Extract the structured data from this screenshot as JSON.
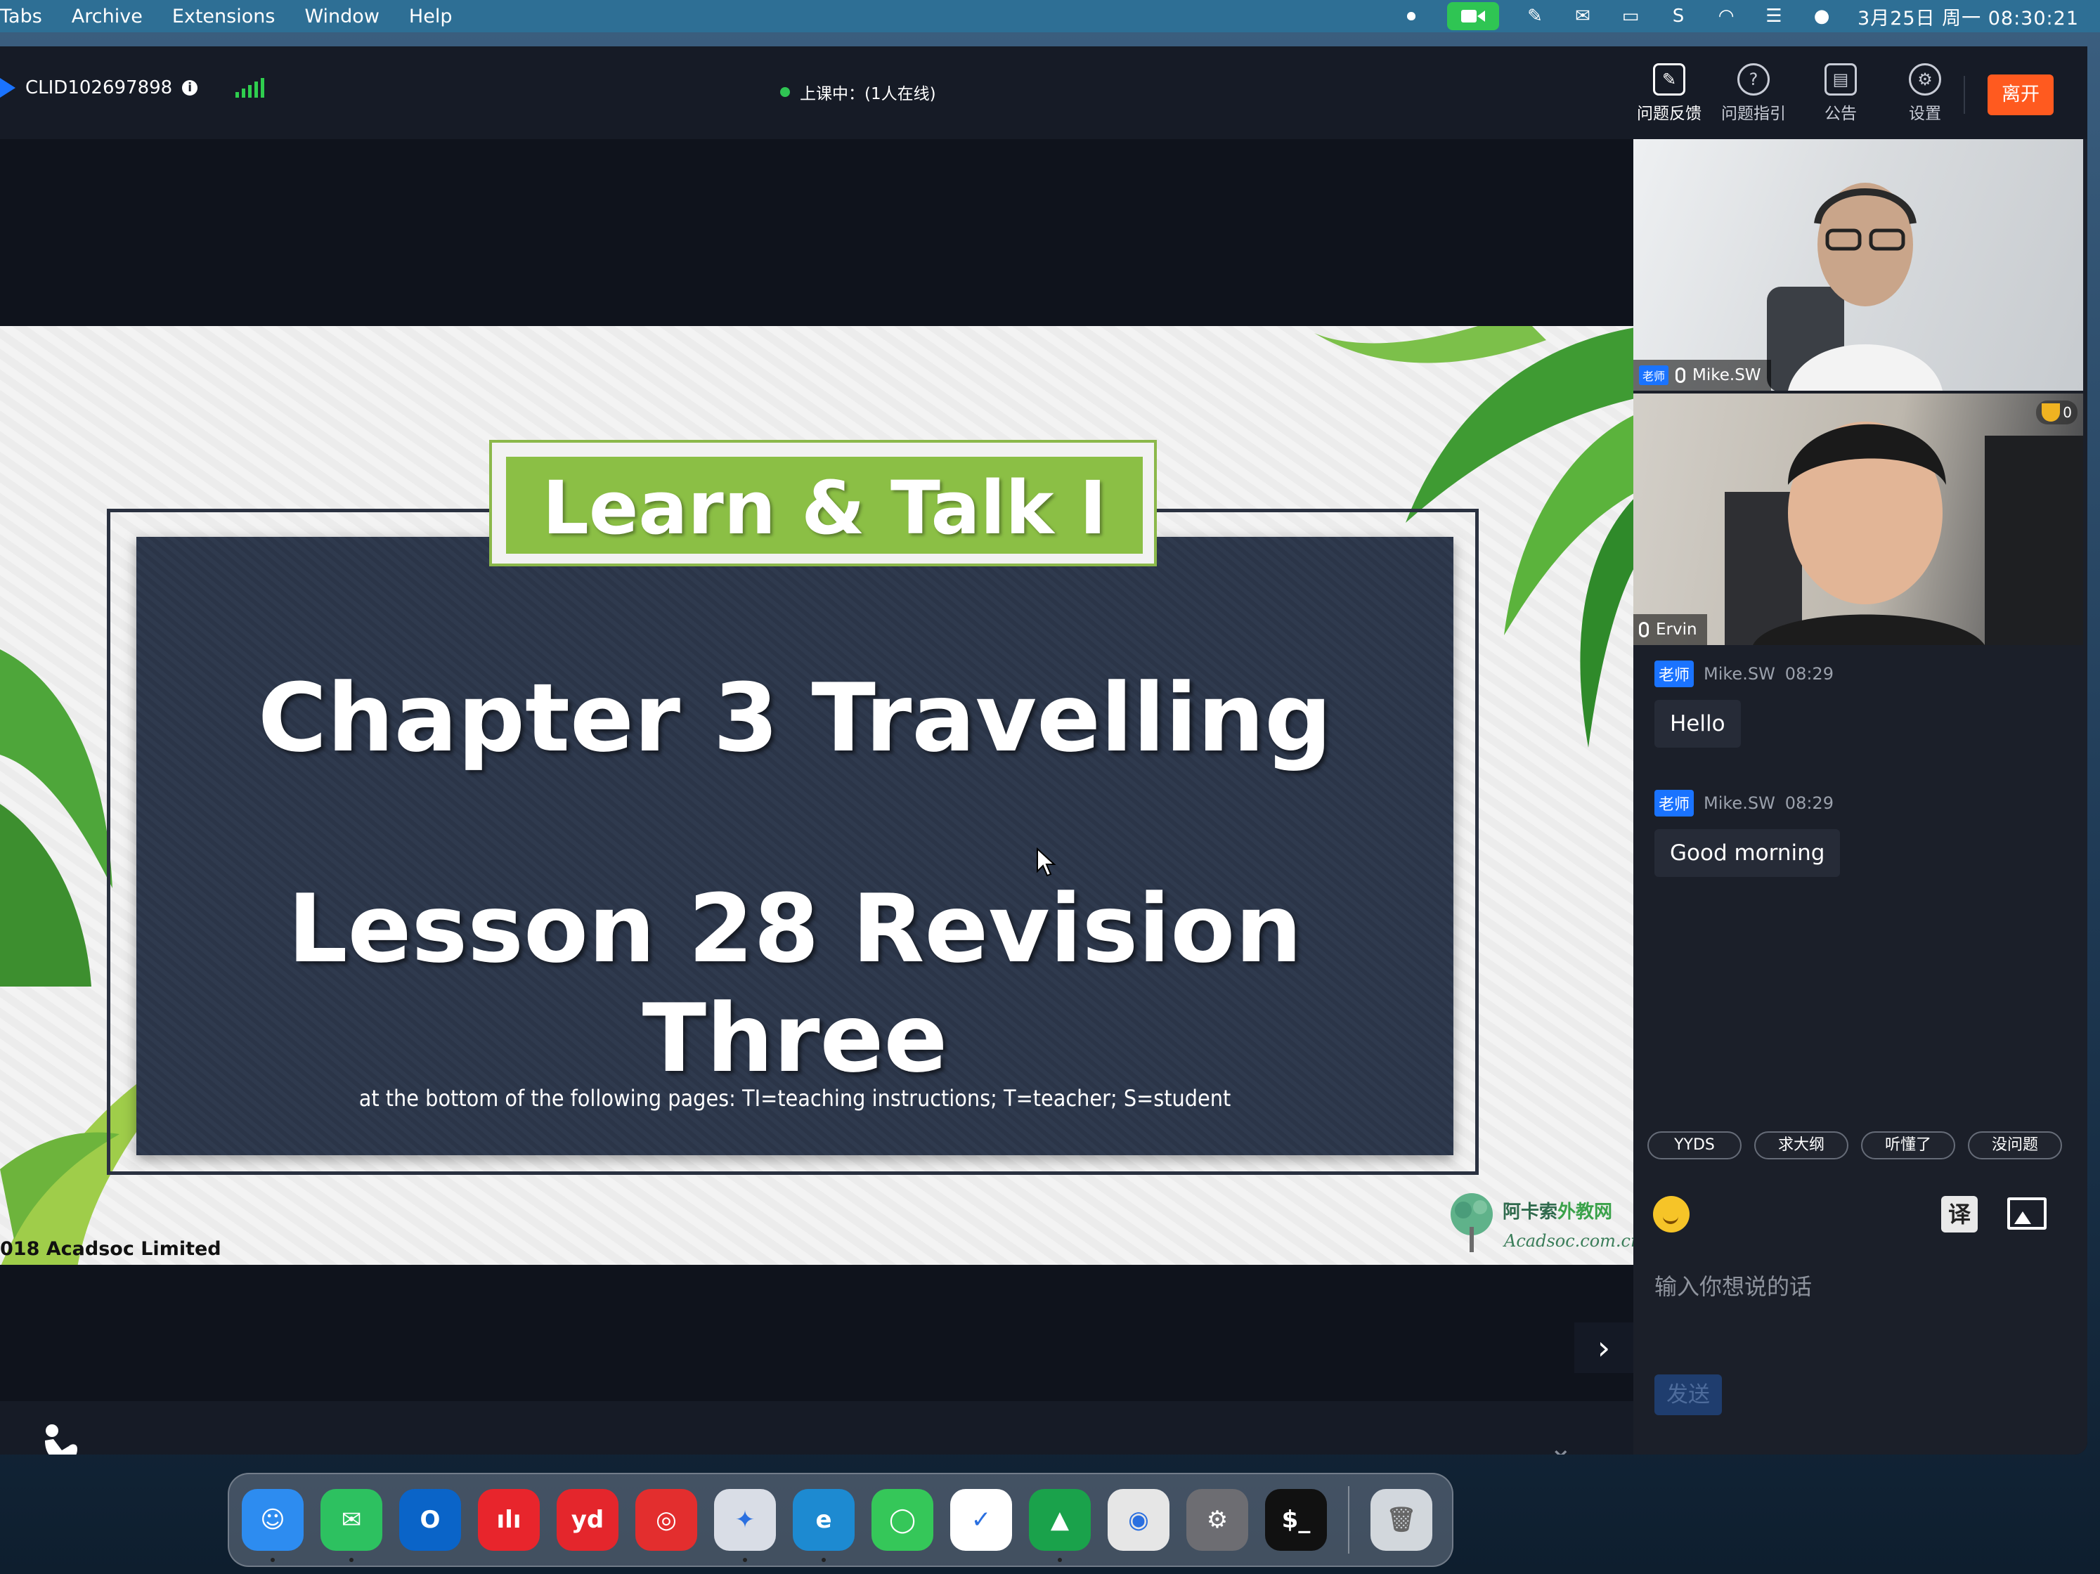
{
  "menubar": {
    "items": [
      "Tabs",
      "Archive",
      "Extensions",
      "Window",
      "Help"
    ],
    "clock": "3月25日 周一  08:30:21"
  },
  "topbar": {
    "clid": "CLID102697898",
    "status": "上课中：(1人在线)",
    "tools": [
      "问题反馈",
      "问题指引",
      "公告",
      "设置"
    ],
    "leave": "离开"
  },
  "slide": {
    "ribbon": "Learn & Talk I",
    "title1": "Chapter 3 Travelling",
    "title2": "Lesson 28 Revision Three",
    "note": "at the bottom of the following pages: TI=teaching instructions; T=teacher; S=student",
    "copyright": "018 Acadsoc Limited",
    "logo_cn_a": "阿卡索",
    "logo_cn_b": "外教网",
    "logo_url": "Acadsoc.com.cn"
  },
  "videos": {
    "teacher_badge": "老师",
    "teacher_name": "Mike.SW",
    "student_name": "Ervin",
    "trophy_count": "0"
  },
  "chat": {
    "messages": [
      {
        "badge": "老师",
        "sender": "Mike.SW",
        "time": "08:29",
        "text": "Hello"
      },
      {
        "badge": "老师",
        "sender": "Mike.SW",
        "time": "08:29",
        "text": "Good morning"
      }
    ],
    "quick_replies": [
      "YYDS",
      "求大纲",
      "听懂了",
      "没问题"
    ],
    "translate_label": "译",
    "placeholder": "输入你想说的话",
    "send": "发送"
  },
  "dock": {
    "apps": [
      {
        "icon": "finder-icon",
        "color": "#2d8cf0",
        "glyph": "☺"
      },
      {
        "icon": "wechat-icon",
        "color": "#2dc160",
        "glyph": "✉"
      },
      {
        "icon": "outlook-icon",
        "color": "#0a64c8",
        "glyph": "O"
      },
      {
        "icon": "iqiyi-icon",
        "color": "#e8252c",
        "glyph": "ılı"
      },
      {
        "icon": "youdao-icon",
        "color": "#e4262c",
        "glyph": "yd"
      },
      {
        "icon": "netease-music-icon",
        "color": "#e32e2e",
        "glyph": "◎"
      },
      {
        "icon": "app-store-tool-icon",
        "color": "#d9dde6",
        "glyph": "✦"
      },
      {
        "icon": "edge-icon",
        "color": "#1d8ad1",
        "glyph": "e"
      },
      {
        "icon": "messages-icon",
        "color": "#35c759",
        "glyph": "◯"
      },
      {
        "icon": "ticktick-icon",
        "color": "#ffffff",
        "glyph": "✓"
      },
      {
        "icon": "green-app-icon",
        "color": "#1aa24b",
        "glyph": "▲"
      },
      {
        "icon": "screenshot-icon",
        "color": "#e6e6e6",
        "glyph": "◉"
      },
      {
        "icon": "system-settings-icon",
        "color": "#6d6d72",
        "glyph": "⚙"
      },
      {
        "icon": "terminal-icon",
        "color": "#111111",
        "glyph": "$_"
      }
    ],
    "trash_icon": "trash-icon"
  }
}
